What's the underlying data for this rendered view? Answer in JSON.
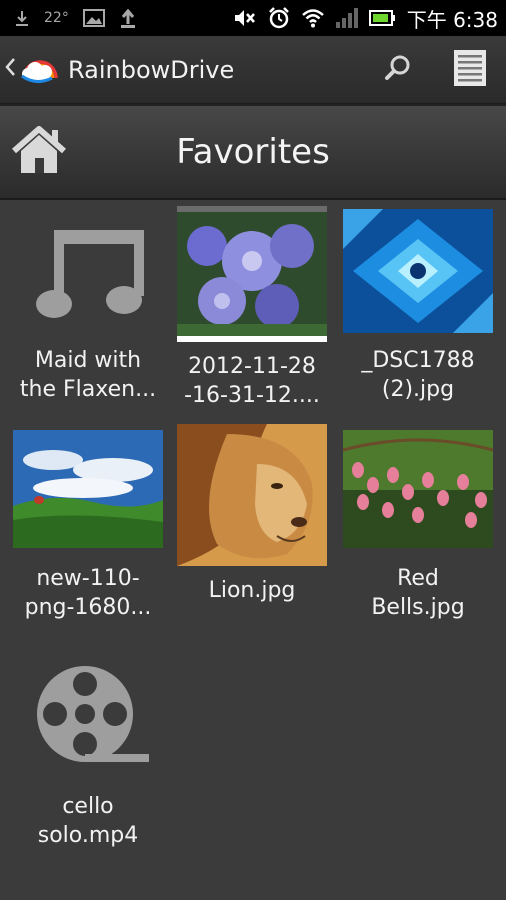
{
  "status_bar": {
    "temperature": "22°",
    "time": "下午 6:38",
    "icons": [
      "download-icon",
      "image-icon",
      "upload-icon",
      "mute-icon",
      "alarm-icon",
      "wifi-icon",
      "signal-icon",
      "battery-icon"
    ]
  },
  "action_bar": {
    "title": "RainbowDrive",
    "icons": [
      "back-chevron-icon",
      "rainbow-cloud-logo",
      "search-icon",
      "menu-icon"
    ]
  },
  "header": {
    "title": "Favorites",
    "home_icon": "home-icon"
  },
  "items": [
    {
      "label": "Maid with the Flaxen...",
      "kind": "music",
      "icon": "music-note-icon"
    },
    {
      "label": "2012-11-28-16-31-12....",
      "kind": "image",
      "icon": "flowers-thumbnail"
    },
    {
      "label": "_DSC1788 (2).jpg",
      "kind": "image",
      "icon": "crystal-thumbnail"
    },
    {
      "label": "new-110-png-1680...",
      "kind": "image",
      "icon": "landscape-thumbnail"
    },
    {
      "label": "Lion.jpg",
      "kind": "image",
      "icon": "lion-thumbnail"
    },
    {
      "label": "Red Bells.jpg",
      "kind": "image",
      "icon": "red-bells-thumbnail"
    },
    {
      "label": "cello solo.mp4",
      "kind": "video",
      "icon": "film-reel-icon"
    }
  ],
  "labels_display": [
    [
      "Maid with",
      "the Flaxen..."
    ],
    [
      "2012-11-28",
      "-16-31-12...."
    ],
    [
      "_DSC1788",
      "(2).jpg"
    ],
    [
      "new-110-",
      "png-1680..."
    ],
    [
      "Lion.jpg"
    ],
    [
      "Red",
      "Bells.jpg"
    ],
    [
      "cello",
      "solo.mp4"
    ]
  ],
  "colors": {
    "background": "#3b3b3b",
    "status_bar": "#000000",
    "action_bar": "#2f2f2f",
    "icon_gray": "#9a9a9a"
  }
}
